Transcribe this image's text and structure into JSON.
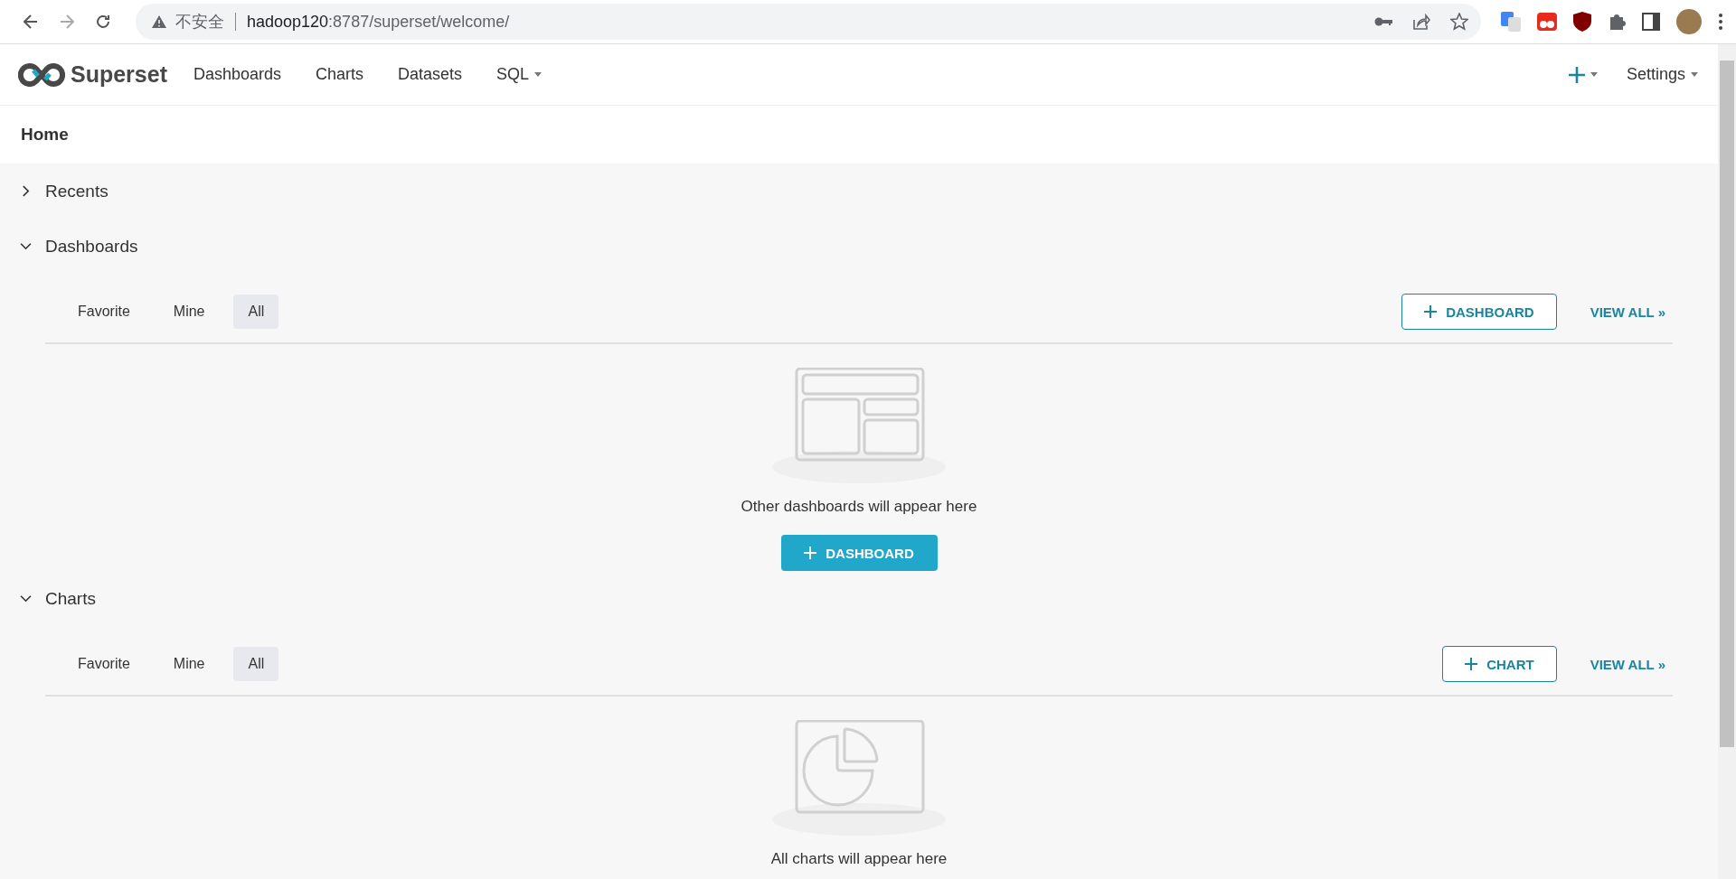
{
  "browser": {
    "security_label": "不安全",
    "url_host": "hadoop120",
    "url_path": ":8787/superset/welcome/"
  },
  "navbar": {
    "brand": "Superset",
    "items": [
      {
        "label": "Dashboards",
        "dropdown": false
      },
      {
        "label": "Charts",
        "dropdown": false
      },
      {
        "label": "Datasets",
        "dropdown": false
      },
      {
        "label": "SQL",
        "dropdown": true
      }
    ],
    "settings": "Settings"
  },
  "page_title": "Home",
  "sections": [
    {
      "label": "Recents",
      "expanded": false
    },
    {
      "kind": "dashboards",
      "label": "Dashboards",
      "expanded": true,
      "tabs": [
        {
          "label": "Favorite",
          "selected": false
        },
        {
          "label": "Mine",
          "selected": false
        },
        {
          "label": "All",
          "selected": true
        }
      ],
      "create_button": "DASHBOARD",
      "view_all": "VIEW ALL »",
      "empty_text": "Other dashboards will appear here",
      "empty_button": "DASHBOARD"
    },
    {
      "kind": "charts",
      "label": "Charts",
      "expanded": true,
      "tabs": [
        {
          "label": "Favorite",
          "selected": false
        },
        {
          "label": "Mine",
          "selected": false
        },
        {
          "label": "All",
          "selected": true
        }
      ],
      "create_button": "CHART",
      "view_all": "VIEW ALL »",
      "empty_text": "All charts will appear here"
    }
  ]
}
